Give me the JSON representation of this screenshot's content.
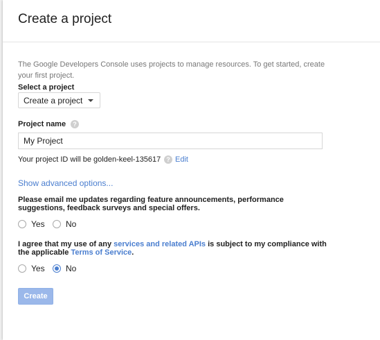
{
  "dialog": {
    "title": "Create a project",
    "intro": "The Google Developers Console uses projects to manage resources. To get started, create your first project."
  },
  "select_project": {
    "label": "Select a project",
    "selected": "Create a project"
  },
  "project_name": {
    "label": "Project name",
    "help_icon": "question-icon",
    "value": "My Project"
  },
  "project_id": {
    "text": "Your project ID will be golden-keel-135617",
    "edit_label": "Edit"
  },
  "advanced_link": "Show advanced options...",
  "email_updates": {
    "question": "Please email me updates regarding feature announcements, performance suggestions, feedback surveys and special offers.",
    "yes_label": "Yes",
    "no_label": "No",
    "selected": null
  },
  "terms": {
    "text_before": "I agree that my use of any ",
    "services_link": "services and related APIs",
    "text_middle": " is subject to my compliance with the applicable ",
    "terms_link": "Terms of Service",
    "text_end": ".",
    "yes_label": "Yes",
    "no_label": "No",
    "selected": "No"
  },
  "create_button": "Create",
  "colors": {
    "link": "#4a7ecf",
    "button_disabled": "#9bb8ea",
    "radio_selected": "#4a7ecf"
  }
}
